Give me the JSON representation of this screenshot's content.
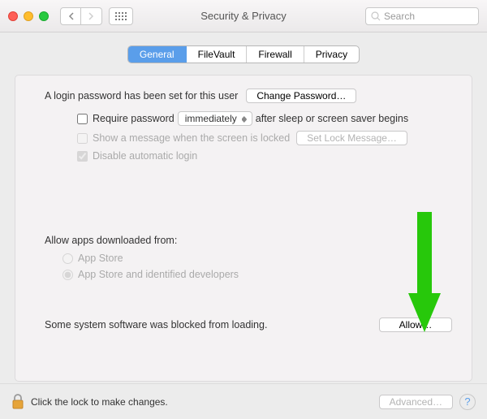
{
  "window": {
    "title": "Security & Privacy",
    "search_placeholder": "Search"
  },
  "tabs": {
    "items": [
      "General",
      "FileVault",
      "Firewall",
      "Privacy"
    ],
    "active_index": 0
  },
  "panel": {
    "login_password_text": "A login password has been set for this user",
    "change_password_label": "Change Password…",
    "require_password_label": "Require password",
    "require_password_delay": "immediately",
    "require_password_tail": "after sleep or screen saver begins",
    "show_message_label": "Show a message when the screen is locked",
    "set_lock_message_label": "Set Lock Message…",
    "disable_auto_login_label": "Disable automatic login",
    "allow_apps_heading": "Allow apps downloaded from:",
    "allow_apps_options": [
      "App Store",
      "App Store and identified developers"
    ],
    "allow_apps_selected_index": 1,
    "blocked_software_text": "Some system software was blocked from loading.",
    "allow_button_label": "Allow…"
  },
  "footer": {
    "lock_text": "Click the lock to make changes.",
    "advanced_label": "Advanced…"
  }
}
